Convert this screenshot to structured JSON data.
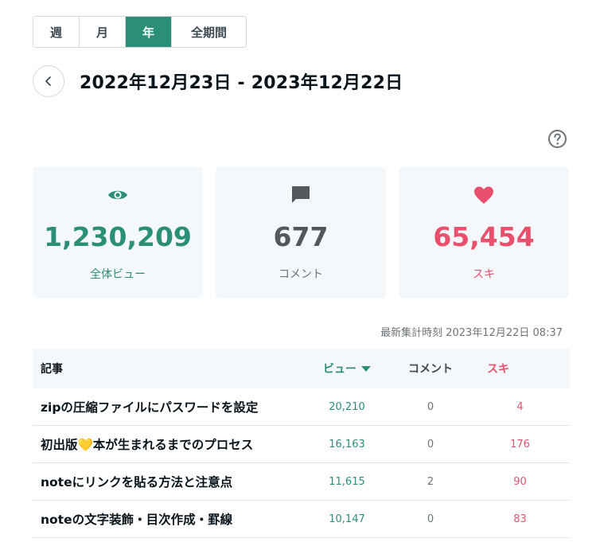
{
  "period_tabs": [
    {
      "label": "週",
      "active": false
    },
    {
      "label": "月",
      "active": false
    },
    {
      "label": "年",
      "active": true
    },
    {
      "label": "全期間",
      "active": false
    }
  ],
  "date_range": {
    "text": "2022年12月23日  -  2023年12月22日"
  },
  "help_icon": "question-circle-icon",
  "stats": {
    "views": {
      "value": "1,230,209",
      "label": "全体ビュー",
      "icon": "eye-icon",
      "color": "#2b8f77"
    },
    "comments": {
      "value": "677",
      "label": "コメント",
      "icon": "comment-icon",
      "color": "#53585d"
    },
    "likes": {
      "value": "65,454",
      "label": "スキ",
      "icon": "heart-icon",
      "color": "#e8506d"
    }
  },
  "last_updated": "最新集計時刻 2023年12月22日 08:37",
  "table": {
    "headers": {
      "title": "記事",
      "views": "ビュー",
      "comments": "コメント",
      "likes": "スキ"
    },
    "rows": [
      {
        "title": "zipの圧縮ファイルにパスワードを設定",
        "views": "20,210",
        "comments": "0",
        "likes": "4"
      },
      {
        "title": "初出版💛本が生まれるまでのプロセス",
        "views": "16,163",
        "comments": "0",
        "likes": "176"
      },
      {
        "title": "noteにリンクを貼る方法と注意点",
        "views": "11,615",
        "comments": "2",
        "likes": "90"
      },
      {
        "title": "noteの文字装飾・目次作成・罫線",
        "views": "10,147",
        "comments": "0",
        "likes": "83"
      }
    ]
  },
  "colors": {
    "accent": "#2b8f77",
    "like": "#e8506d",
    "card_bg": "#f5f8fa"
  }
}
